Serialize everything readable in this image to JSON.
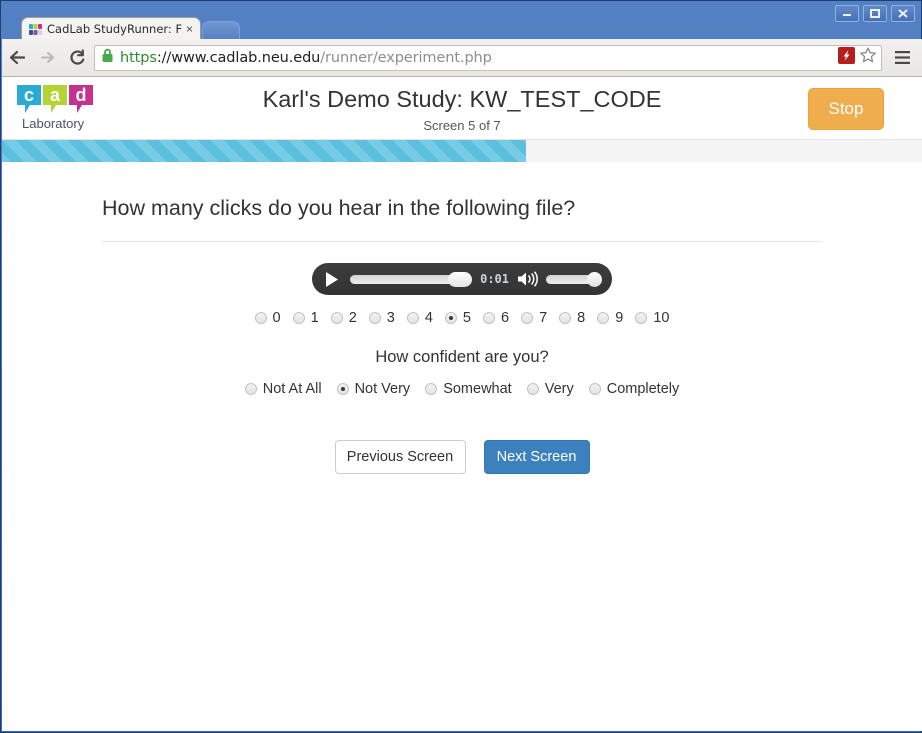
{
  "browser": {
    "tab": {
      "title": "CadLab StudyRunner: F",
      "close_label": "×",
      "favicon": "cadlab-favicon"
    },
    "window_controls": {
      "minimize": "minimize-icon",
      "maximize": "maximize-icon",
      "close": "close-icon"
    },
    "toolbar": {
      "back": "back-arrow-icon",
      "forward": "forward-arrow-icon",
      "reload": "reload-icon",
      "lock": "lock-icon",
      "url_scheme": "https",
      "url_separator": "://",
      "url_host": "www.cadlab.neu.edu",
      "url_path": "/runner/experiment.php",
      "flash_icon": "flash-plugin-icon",
      "bookmark": "star-icon",
      "menu": "hamburger-menu-icon"
    }
  },
  "page": {
    "logo": {
      "letters": [
        "c",
        "a",
        "d"
      ],
      "wordmark": "Laboratory",
      "colors": {
        "c": "#29abd6",
        "a": "#b5d334",
        "d": "#c6308f",
        "wordmark": "#4b4f74"
      }
    },
    "header": {
      "study_title": "Karl's Demo Study: KW_TEST_CODE",
      "screen_count": "Screen 5 of 7",
      "stop_label": "Stop",
      "stop_color": "#efad4e"
    },
    "progress": {
      "percent": 57,
      "color": "#5bc0de"
    },
    "question": "How many clicks do you hear in the following file?",
    "audio": {
      "play_icon": "play-icon",
      "time": "0:01",
      "volume_icon": "speaker-icon",
      "seek_percent": 100,
      "volume_percent": 100
    },
    "count_question": {
      "options": [
        "0",
        "1",
        "2",
        "3",
        "4",
        "5",
        "6",
        "7",
        "8",
        "9",
        "10"
      ],
      "selected": "5"
    },
    "confidence": {
      "title": "How confident are you?",
      "options": [
        "Not At All",
        "Not Very",
        "Somewhat",
        "Very",
        "Completely"
      ],
      "selected": "Not Very"
    },
    "navigation": {
      "previous_label": "Previous Screen",
      "next_label": "Next Screen",
      "next_color": "#3c81be"
    }
  }
}
